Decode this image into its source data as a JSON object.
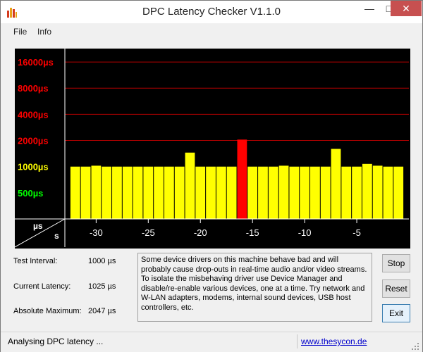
{
  "window": {
    "title": "DPC Latency Checker V1.1.0",
    "minimize_glyph": "—",
    "maximize_glyph": "□",
    "close_glyph": "✕"
  },
  "menu": {
    "file": "File",
    "info": "Info"
  },
  "chart_data": {
    "type": "bar",
    "title": "",
    "y_unit_label": "µs",
    "x_unit_label": "s",
    "y_ticks": [
      {
        "label": "500µs",
        "value": 500,
        "color": "#00ff00"
      },
      {
        "label": "1000µs",
        "value": 1000,
        "color": "#ffff00"
      },
      {
        "label": "2000µs",
        "value": 2000,
        "color": "#ff0000"
      },
      {
        "label": "4000µs",
        "value": 4000,
        "color": "#ff0000"
      },
      {
        "label": "8000µs",
        "value": 8000,
        "color": "#ff0000"
      },
      {
        "label": "16000µs",
        "value": 16000,
        "color": "#ff0000"
      }
    ],
    "x_ticks": [
      {
        "label": "-30",
        "value": -30
      },
      {
        "label": "-25",
        "value": -25
      },
      {
        "label": "-20",
        "value": -20
      },
      {
        "label": "-15",
        "value": -15
      },
      {
        "label": "-10",
        "value": -10
      },
      {
        "label": "-5",
        "value": -5
      }
    ],
    "x_range": [
      -33,
      0
    ],
    "y_scale": "log2",
    "y_range": [
      250,
      22000
    ],
    "series": [
      {
        "x": [
          -32,
          -31,
          -30,
          -29,
          -28,
          -27,
          -26,
          -25,
          -24,
          -23,
          -22,
          -21,
          -20,
          -19,
          -18,
          -17,
          -16,
          -15,
          -14,
          -13,
          -12,
          -11,
          -10,
          -9,
          -8,
          -7,
          -6,
          -5,
          -4,
          -3,
          -2,
          -1
        ],
        "values": [
          1000,
          1000,
          1025,
          1000,
          1000,
          1000,
          1000,
          1000,
          1000,
          1000,
          1000,
          1450,
          1000,
          1000,
          1000,
          1000,
          2047,
          1000,
          1000,
          1000,
          1025,
          1000,
          1000,
          1000,
          1000,
          1600,
          1000,
          1000,
          1075,
          1025,
          1000,
          1000
        ],
        "colors": [
          "#ffff00",
          "#ffff00",
          "#ffff00",
          "#ffff00",
          "#ffff00",
          "#ffff00",
          "#ffff00",
          "#ffff00",
          "#ffff00",
          "#ffff00",
          "#ffff00",
          "#ffff00",
          "#ffff00",
          "#ffff00",
          "#ffff00",
          "#ffff00",
          "#ff0000",
          "#ffff00",
          "#ffff00",
          "#ffff00",
          "#ffff00",
          "#ffff00",
          "#ffff00",
          "#ffff00",
          "#ffff00",
          "#ffff00",
          "#ffff00",
          "#ffff00",
          "#ffff00",
          "#ffff00",
          "#ffff00",
          "#ffff00"
        ]
      }
    ],
    "background": "#000000",
    "gridline_color": "#b00000",
    "grid": true
  },
  "info": {
    "test_interval_label": "Test Interval:",
    "test_interval_value": "1000 µs",
    "current_latency_label": "Current Latency:",
    "current_latency_value": "1025 µs",
    "absolute_maximum_label": "Absolute Maximum:",
    "absolute_maximum_value": "2047 µs"
  },
  "message": "Some device drivers on this machine behave bad and will probably cause drop-outs in real-time audio and/or video streams. To isolate the misbehaving driver use Device Manager and disable/re-enable various devices, one at a time. Try network and W-LAN adapters, modems, internal sound devices, USB host controllers, etc.",
  "buttons": {
    "stop": "Stop",
    "reset": "Reset",
    "exit": "Exit"
  },
  "status": {
    "text": "Analysing DPC latency ...",
    "link": "www.thesycon.de"
  }
}
